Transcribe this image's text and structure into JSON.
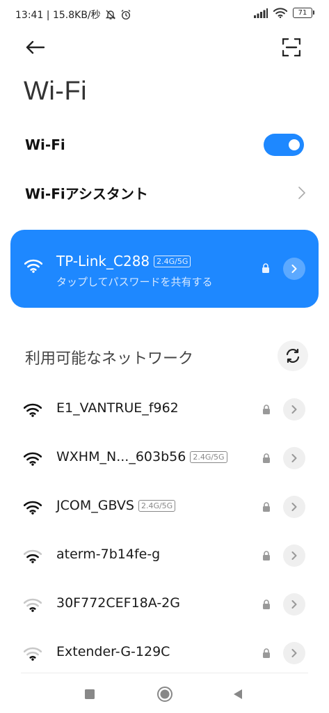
{
  "status_bar": {
    "time_speed": "13:41 | 15.8KB/秒",
    "battery": "71",
    "icons": [
      "muted-bell-icon",
      "alarm-icon",
      "cell-signal-icon",
      "wifi-icon",
      "battery-icon"
    ]
  },
  "header": {
    "title": "Wi-Fi",
    "icons": [
      "back-arrow-icon",
      "qr-scan-icon"
    ]
  },
  "settings": {
    "wifi_label": "Wi-Fi",
    "wifi_enabled": true,
    "assistant_label": "Wi-Fiアシスタント"
  },
  "connected": {
    "name": "TP-Link_C288",
    "band": "2.4G/5G",
    "subtitle": "タップしてパスワードを共有する"
  },
  "available": {
    "title": "利用可能なネットワーク",
    "networks": [
      {
        "name": "E1_VANTRUE_f962",
        "band": "",
        "secured": true,
        "signal": 4
      },
      {
        "name": "WXHM_N..._603b56",
        "band": "2.4G/5G",
        "secured": true,
        "signal": 4
      },
      {
        "name": "JCOM_GBVS",
        "band": "2.4G/5G",
        "secured": true,
        "signal": 4
      },
      {
        "name": "aterm-7b14fe-g",
        "band": "",
        "secured": true,
        "signal": 3
      },
      {
        "name": "30F772CEF18A-2G",
        "band": "",
        "secured": true,
        "signal": 2
      },
      {
        "name": "Extender-G-129C",
        "band": "",
        "secured": true,
        "signal": 2
      }
    ]
  },
  "colors": {
    "accent": "#1e88ff",
    "text_primary": "#111111",
    "text_muted": "#888888"
  }
}
